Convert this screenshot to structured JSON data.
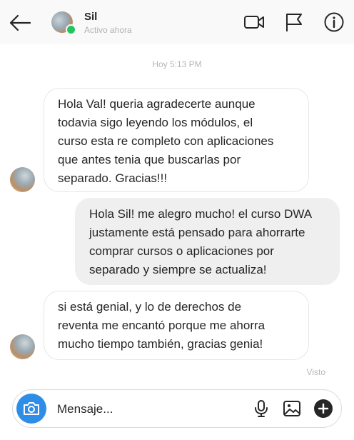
{
  "header": {
    "contact_name": "Sil",
    "contact_status": "Activo ahora",
    "icons": [
      "back-arrow-icon",
      "video-camera-icon",
      "flag-icon",
      "info-icon"
    ]
  },
  "conversation": {
    "timestamp": "Hoy 5:13 PM",
    "messages": [
      {
        "from": "contact",
        "text": "Hola Val! queria agradecerte aunque\ntodavia sigo leyendo los módulos, el\ncurso esta re completo con aplicaciones\nque antes tenia que buscarlas por\nseparado. Gracias!!!"
      },
      {
        "from": "me",
        "text": "Hola Sil! me alegro mucho! el curso DWA\njustamente está pensado para ahorrarte\ncomprar cursos o aplicaciones por\nseparado y siempre se actualiza!"
      },
      {
        "from": "contact",
        "text": "si está genial, y lo de derechos de\nreventa me encantó porque me ahorra\nmucho tiempo también, gracias genia!"
      }
    ],
    "seen_label": "Visto"
  },
  "composer": {
    "placeholder": "Mensaje...",
    "icons": [
      "camera-icon",
      "microphone-icon",
      "image-icon",
      "plus-icon"
    ],
    "accent_color": "#2e8de6"
  }
}
